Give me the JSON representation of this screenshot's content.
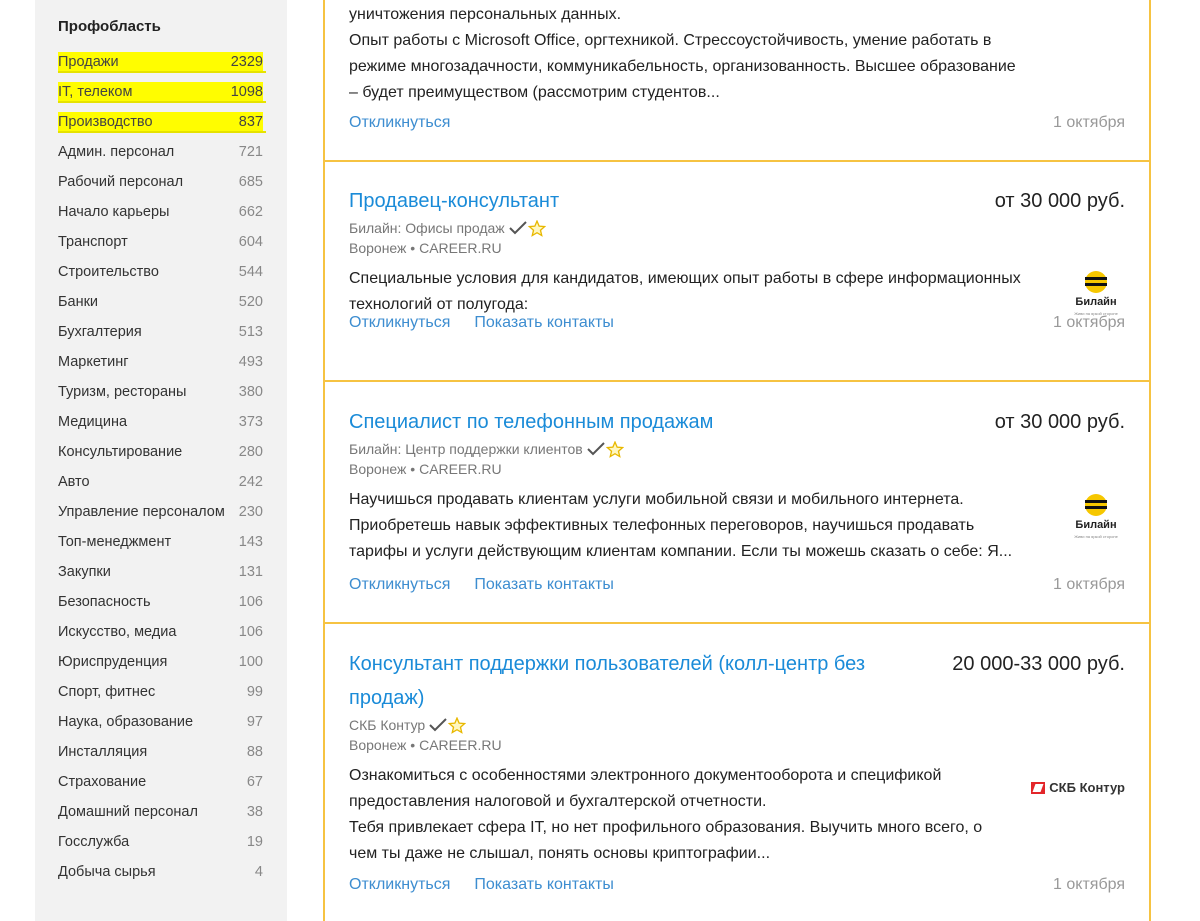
{
  "sidebar": {
    "title": "Профобласть",
    "categories": [
      {
        "name": "Продажи",
        "count": "2329"
      },
      {
        "name": "IT, телеком",
        "count": "1098"
      },
      {
        "name": "Производство",
        "count": "837"
      },
      {
        "name": "Админ. персонал",
        "count": "721"
      },
      {
        "name": "Рабочий персонал",
        "count": "685"
      },
      {
        "name": "Начало карьеры",
        "count": "662"
      },
      {
        "name": "Транспорт",
        "count": "604"
      },
      {
        "name": "Строительство",
        "count": "544"
      },
      {
        "name": "Банки",
        "count": "520"
      },
      {
        "name": "Бухгалтерия",
        "count": "513"
      },
      {
        "name": "Маркетинг",
        "count": "493"
      },
      {
        "name": "Туризм, рестораны",
        "count": "380"
      },
      {
        "name": "Медицина",
        "count": "373"
      },
      {
        "name": "Консультирование",
        "count": "280"
      },
      {
        "name": "Авто",
        "count": "242"
      },
      {
        "name": "Управление персоналом",
        "count": "230"
      },
      {
        "name": "Топ-менеджмент",
        "count": "143"
      },
      {
        "name": "Закупки",
        "count": "131"
      },
      {
        "name": "Безопасность",
        "count": "106"
      },
      {
        "name": "Искусство, медиа",
        "count": "106"
      },
      {
        "name": "Юриспруденция",
        "count": "100"
      },
      {
        "name": "Спорт, фитнес",
        "count": "99"
      },
      {
        "name": "Наука, образование",
        "count": "97"
      },
      {
        "name": "Инсталляция",
        "count": "88"
      },
      {
        "name": "Страхование",
        "count": "67"
      },
      {
        "name": "Домашний персонал",
        "count": "38"
      },
      {
        "name": "Госслужба",
        "count": "19"
      },
      {
        "name": "Добыча сырья",
        "count": "4"
      }
    ]
  },
  "jobs": [
    {
      "desc_lines": [
        "уничтожения персональных данных.",
        "Опыт работы с Microsoft Office, оргтехникой. Стрессоустойчивость, умение работать в",
        "режиме многозадачности, коммуникабельность, организованность. Высшее образование",
        "– будет преимуществом (рассмотрим студентов..."
      ],
      "respond": "Откликнуться",
      "date": "1 октября"
    },
    {
      "title": "Продавец-консультант",
      "salary": "от 30 000 руб.",
      "company": "Билайн: Офисы продаж",
      "location": "Воронеж • CAREER.RU",
      "desc_lines": [
        "Специальные условия для кандидатов, имеющих опыт работы в сфере информационных",
        "технологий от полугода:"
      ],
      "respond": "Откликнуться",
      "contacts": "Показать контакты",
      "date": "1 октября",
      "logo": {
        "text": "Билайн",
        "tagline": "Живи на яркой стороне"
      }
    },
    {
      "title": "Специалист по телефонным продажам",
      "salary": "от 30 000 руб.",
      "company": "Билайн: Центр поддержки клиентов",
      "location": "Воронеж • CAREER.RU",
      "desc_lines": [
        "Научишься продавать клиентам услуги мобильной связи и мобильного интернета.",
        "Приобретешь навык эффективных телефонных переговоров, научишься продавать",
        "тарифы и услуги действующим клиентам компании. Если ты можешь сказать о себе: Я..."
      ],
      "respond": "Откликнуться",
      "contacts": "Показать контакты",
      "date": "1 октября",
      "logo": {
        "text": "Билайн",
        "tagline": "Живи на яркой стороне"
      }
    },
    {
      "title_lines": [
        "Консультант поддержки пользователей (колл-центр без",
        "продаж)"
      ],
      "salary": "20 000-33 000 руб.",
      "company": "СКБ Контур",
      "location": "Воронеж • CAREER.RU",
      "desc_lines": [
        "Ознакомиться с особенностями электронного документооборота и спецификой",
        "предоставления налоговой и бухгалтерской отчетности.",
        "Тебя привлекает сфера IT, но нет профильного образования. Выучить много всего, о",
        "чем ты даже не слышал, понять основы криптографии..."
      ],
      "respond": "Откликнуться",
      "contacts": "Показать контакты",
      "date": "1 октября",
      "logo": {
        "text": "СКБ Контур"
      }
    }
  ]
}
